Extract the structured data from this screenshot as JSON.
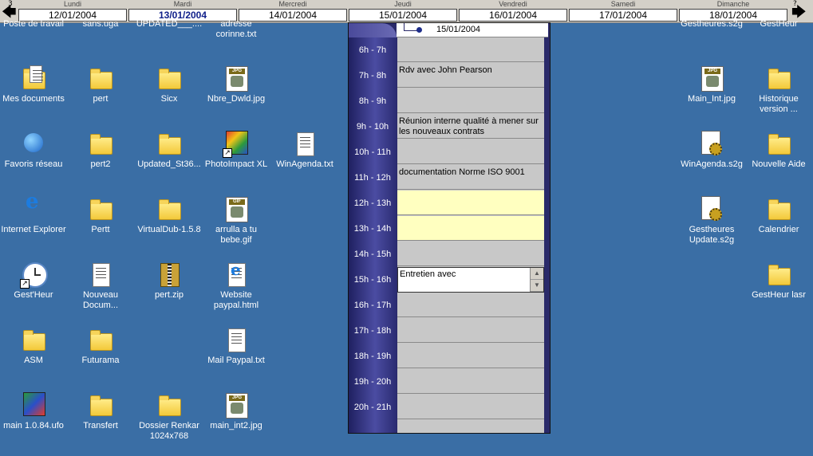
{
  "weekbar": {
    "prev_small": "3",
    "next_small": "?",
    "prev_icon": "arrow-left-icon",
    "next_icon": "arrow-right-icon",
    "days": [
      {
        "name": "Lundi",
        "date": "12/01/2004"
      },
      {
        "name": "Mardi",
        "date": "13/01/2004"
      },
      {
        "name": "Mercredi",
        "date": "14/01/2004"
      },
      {
        "name": "Jeudi",
        "date": "15/01/2004"
      },
      {
        "name": "Vendredi",
        "date": "16/01/2004"
      },
      {
        "name": "Samedi",
        "date": "17/01/2004"
      },
      {
        "name": "Dimanche",
        "date": "18/01/2004"
      }
    ],
    "active_day": "Mardi"
  },
  "agenda": {
    "header_date": "15/01/2004",
    "hours": [
      "6h - 7h",
      "7h - 8h",
      "8h - 9h",
      "9h - 10h",
      "10h - 11h",
      "11h - 12h",
      "12h - 13h",
      "13h - 14h",
      "14h - 15h",
      "15h - 16h",
      "16h - 17h",
      "17h - 18h",
      "18h - 19h",
      "19h - 20h",
      "20h - 21h"
    ],
    "entries": [
      "",
      "Rdv avec John Pearson",
      "",
      "Réunion interne qualité à mener sur les nouveaux contrats",
      "",
      "documentation Norme ISO 9001",
      "",
      "",
      "",
      "Entretien avec",
      "",
      "",
      "",
      "",
      ""
    ],
    "highlight_color": "#ffffc0"
  },
  "desktop": {
    "background": "#3a6ea5",
    "icons_left": [
      {
        "label": "Poste de travail",
        "icon": "computer-icon"
      },
      {
        "label": "sans.uga",
        "icon": "file-icon"
      },
      {
        "label": "UPDATED___....",
        "icon": "file-icon"
      },
      {
        "label": "adresse corinne.txt",
        "icon": "text-file-icon"
      },
      {
        "label": "Mes documents",
        "icon": "my-documents-icon"
      },
      {
        "label": "pert",
        "icon": "folder-icon"
      },
      {
        "label": "Sicx",
        "icon": "folder-icon"
      },
      {
        "label": "Nbre_Dwld.jpg",
        "icon": "jpg-file-icon"
      },
      {
        "label": "Favoris réseau",
        "icon": "network-icon"
      },
      {
        "label": "pert2",
        "icon": "folder-icon"
      },
      {
        "label": "Updated_St36...",
        "icon": "folder-icon"
      },
      {
        "label": "PhotoImpact XL",
        "icon": "photoimpact-icon"
      },
      {
        "label": "WinAgenda.txt",
        "icon": "text-file-icon"
      },
      {
        "label": "Internet Explorer",
        "icon": "internet-explorer-icon"
      },
      {
        "label": "Pertt",
        "icon": "folder-icon"
      },
      {
        "label": "VirtualDub-1.5.8",
        "icon": "folder-icon"
      },
      {
        "label": "arrulla a tu bebe.gif",
        "icon": "gif-file-icon"
      },
      {
        "label": "Gest'Heur",
        "icon": "clock-icon"
      },
      {
        "label": "Nouveau Docum...",
        "icon": "text-file-icon"
      },
      {
        "label": "pert.zip",
        "icon": "zip-file-icon"
      },
      {
        "label": "Website paypal.html",
        "icon": "html-file-icon"
      },
      {
        "label": "ASM",
        "icon": "folder-icon"
      },
      {
        "label": "Futurama",
        "icon": "folder-icon"
      },
      {
        "label": "Mail Paypal.txt",
        "icon": "text-file-icon"
      },
      {
        "label": "main 1.0.84.ufo",
        "icon": "ufo-file-icon"
      },
      {
        "label": "Transfert",
        "icon": "folder-icon"
      },
      {
        "label": "Dossier Renkar 1024x768",
        "icon": "folder-icon"
      },
      {
        "label": "main_int2.jpg",
        "icon": "jpg-file-icon"
      }
    ],
    "icons_right": [
      {
        "label": "Gestheures.s2g",
        "icon": "s2g-file-icon"
      },
      {
        "label": "GestHeur",
        "icon": "folder-icon"
      },
      {
        "label": "Main_Int.jpg",
        "icon": "jpg-file-icon"
      },
      {
        "label": "Historique version ...",
        "icon": "folder-icon"
      },
      {
        "label": "WinAgenda.s2g",
        "icon": "s2g-file-icon"
      },
      {
        "label": "Nouvelle Aide",
        "icon": "folder-icon"
      },
      {
        "label": "Gestheures Update.s2g",
        "icon": "s2g-file-icon"
      },
      {
        "label": "Calendrier",
        "icon": "folder-icon"
      },
      {
        "label": "GestHeur lasr",
        "icon": "folder-icon"
      }
    ]
  }
}
